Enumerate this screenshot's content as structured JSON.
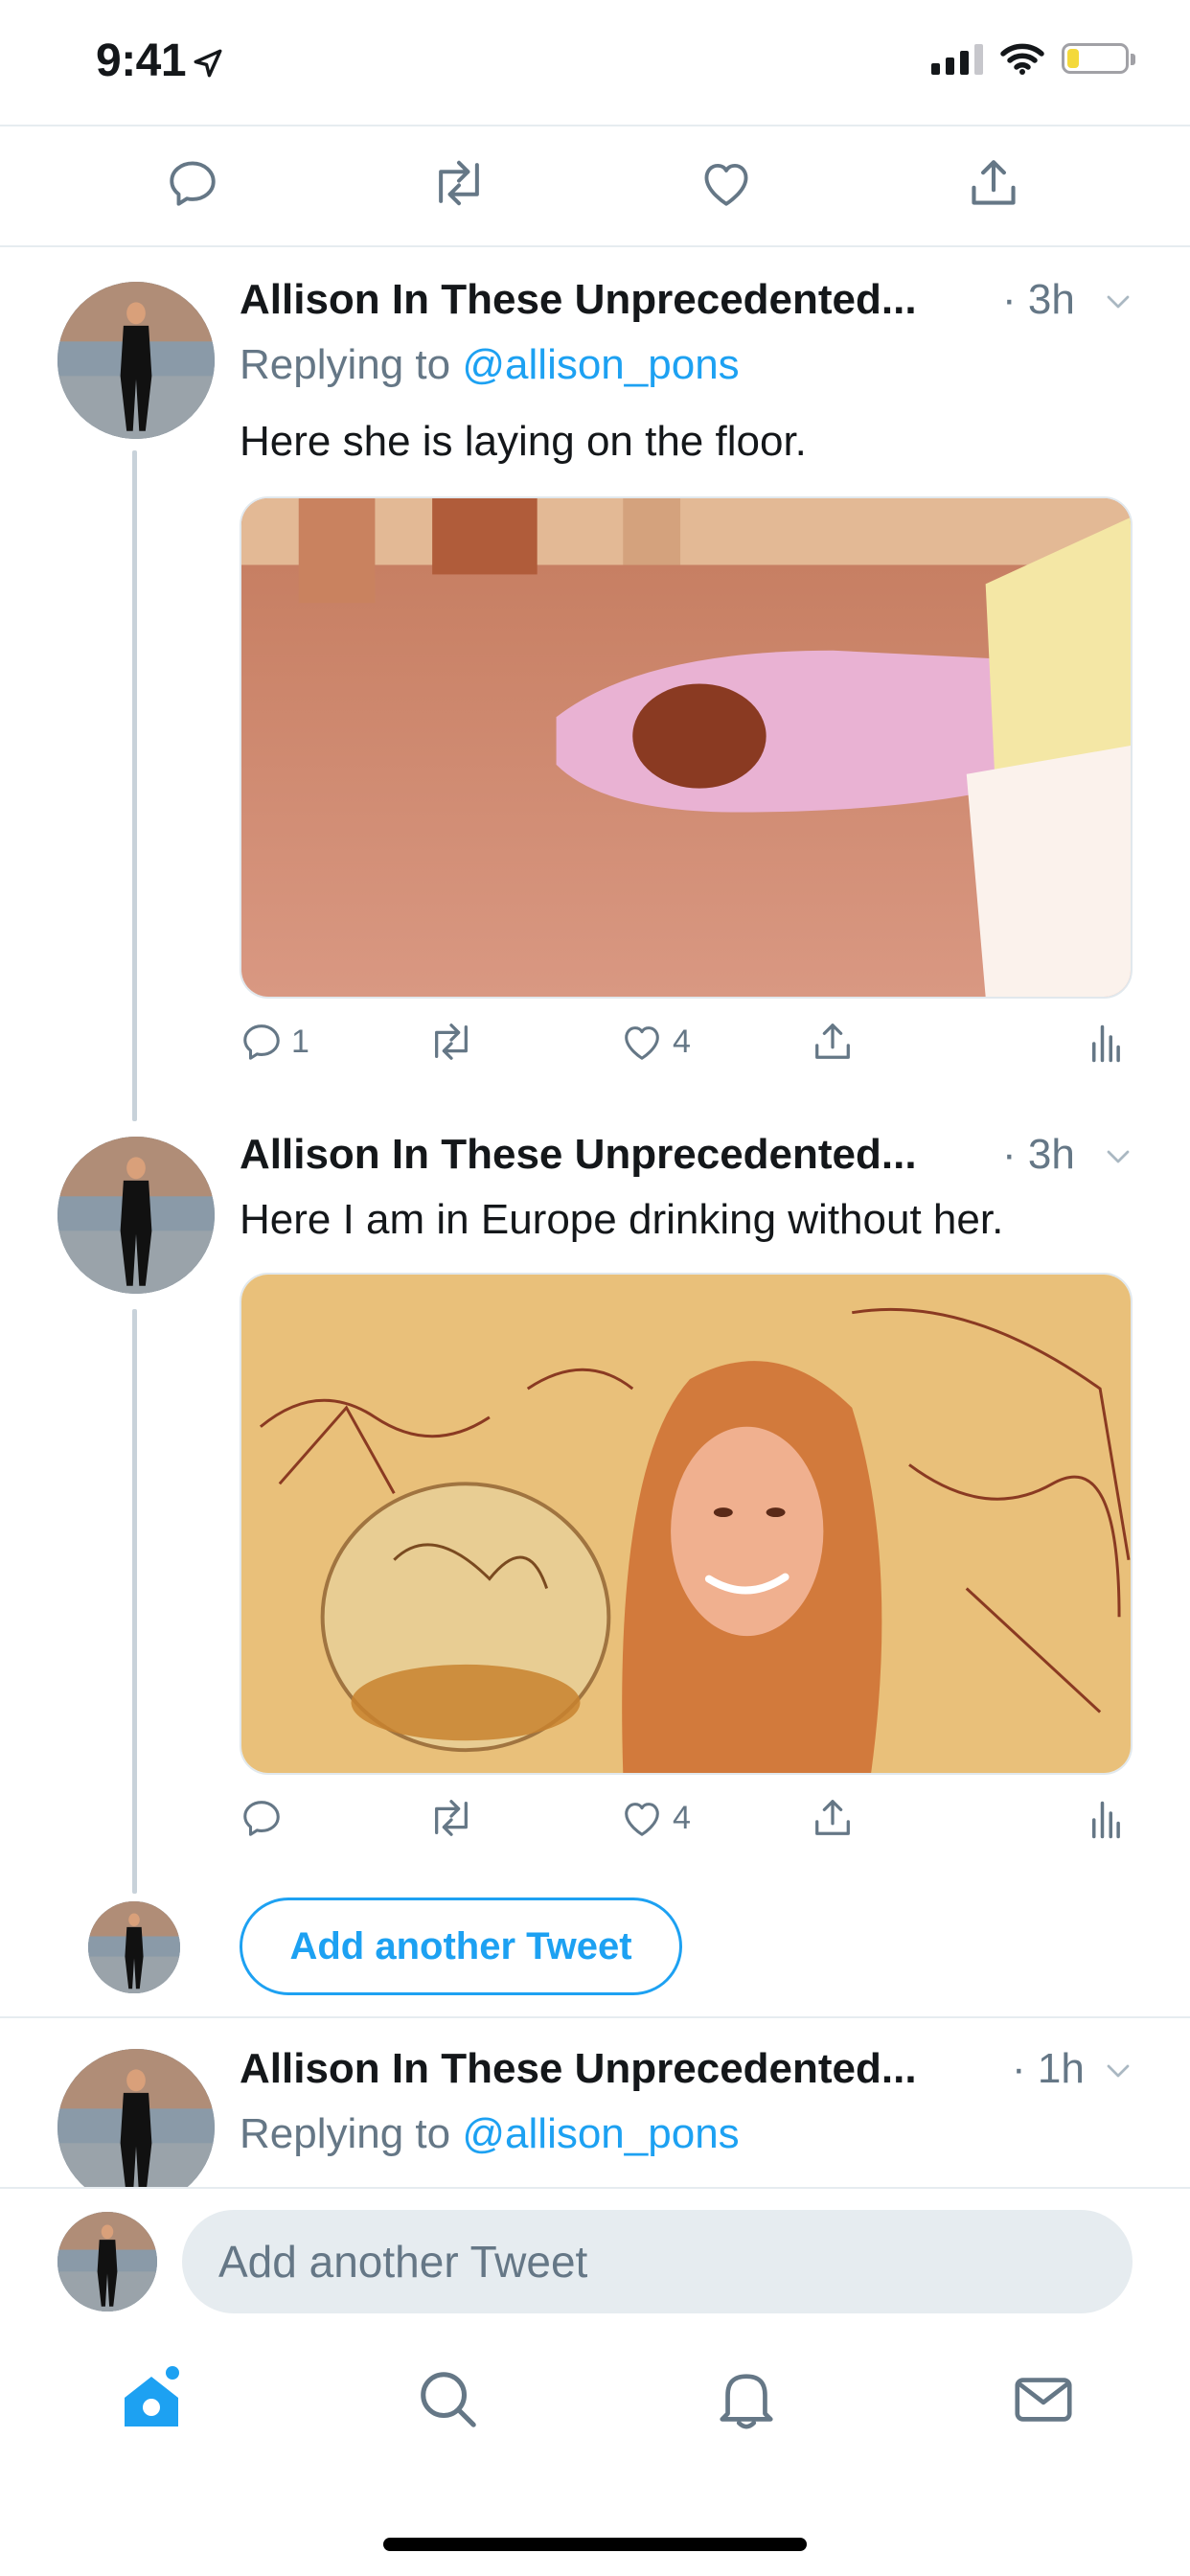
{
  "status": {
    "time": "9:41"
  },
  "thread": [
    {
      "author": "Allison In These Unprecedented...",
      "time": "· 3h",
      "reply_prefix": "Replying to",
      "reply_handle": "@allison_pons",
      "text": "Here she is laying on the floor.",
      "media_description": "photo",
      "counts": {
        "replies": "1",
        "retweets": "",
        "likes": "4"
      }
    },
    {
      "author": "Allison In These Unprecedented...",
      "time": "· 3h",
      "text": "Here I am in Europe drinking without her.",
      "media_description": "photo",
      "counts": {
        "replies": "",
        "retweets": "",
        "likes": "4"
      }
    },
    {
      "author": "Allison In These Unprecedented...",
      "time": "· 1h",
      "reply_prefix": "Replying to",
      "reply_handle": "@allison_pons"
    }
  ],
  "add_tweet_button": "Add another Tweet",
  "compose": {
    "placeholder": "Add another Tweet"
  },
  "tabs": [
    "home",
    "search",
    "notifications",
    "messages"
  ],
  "colors": {
    "accent": "#1da1f2",
    "secondary_text": "#657786",
    "divider": "#e6ecf0"
  }
}
